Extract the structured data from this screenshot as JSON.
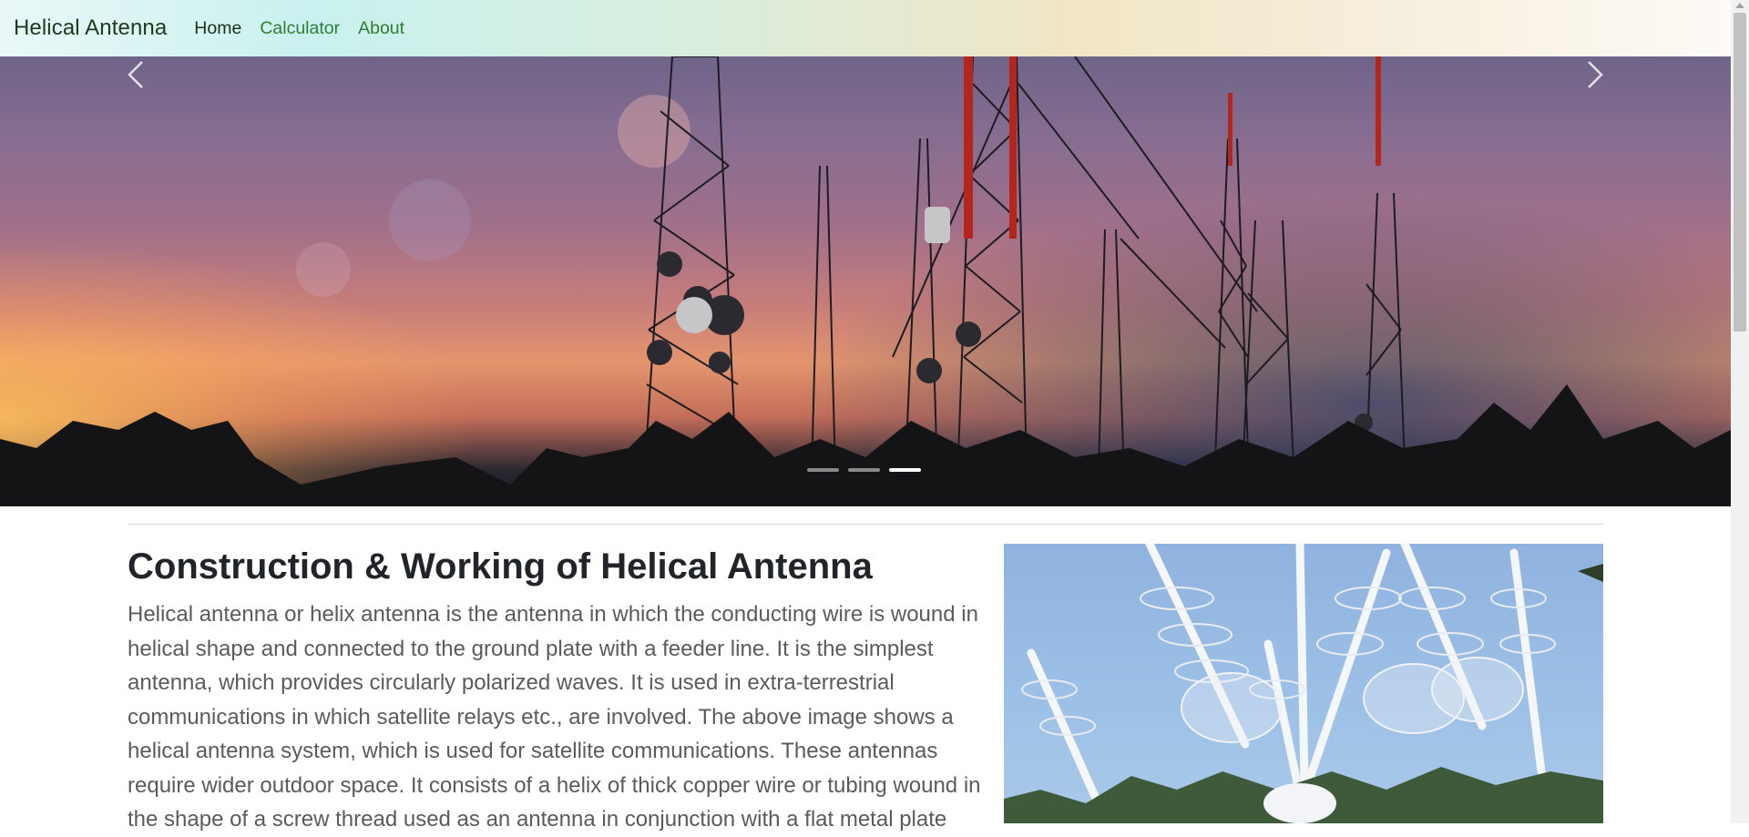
{
  "navbar": {
    "brand": "Helical Antenna",
    "links": [
      {
        "label": "Home",
        "active": true
      },
      {
        "label": "Calculator",
        "active": false
      },
      {
        "label": "About",
        "active": false
      }
    ]
  },
  "carousel": {
    "slide_count": 3,
    "active_slide": 3,
    "prev_icon": "chevron-left-icon",
    "next_icon": "chevron-right-icon"
  },
  "article": {
    "title": "Construction & Working of Helical Antenna",
    "body": "Helical antenna or helix antenna is the antenna in which the conducting wire is wound in helical shape and connected to the ground plate with a feeder line. It is the simplest antenna, which provides circularly polarized waves. It is used in extra-terrestrial communications in which satellite relays etc., are involved. The above image shows a helical antenna system, which is used for satellite communications. These antennas require wider outdoor space. It consists of a helix of thick copper wire or tubing wound in the shape of a screw thread used as an antenna in conjunction with a flat metal plate"
  },
  "colors": {
    "nav_active": "#1a2e1a",
    "nav_link": "#2e7d32",
    "title": "#212529",
    "body_text": "#5b5b5b"
  }
}
